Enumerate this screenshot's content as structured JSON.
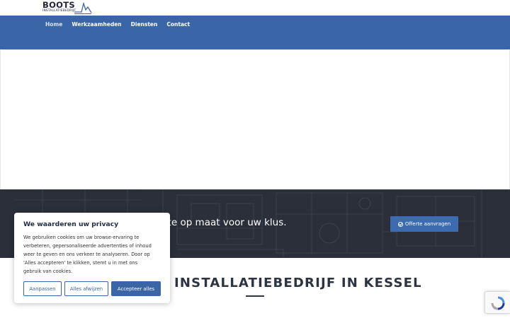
{
  "brand": {
    "name": "BOOTS",
    "tagline": "INSTALLATIEBEDRIJF"
  },
  "nav": {
    "items": [
      {
        "label": "Home"
      },
      {
        "label": "Werkzaamheden"
      },
      {
        "label": "Diensten"
      },
      {
        "label": "Contact"
      }
    ],
    "active": "Home"
  },
  "cta": {
    "text": "rte op maat voor uw klus.",
    "button_label": "Offerte aanvragen",
    "button_icon": "check-circle-icon"
  },
  "section": {
    "title": "INSTALLATIEBEDRIJF IN KESSEL"
  },
  "cookie": {
    "title": "We waarderen uw privacy",
    "body_lines": [
      "We gebruiken cookies om uw browse-ervaring te",
      "verbeteren, gepersonaliseerde advertenties of inhoud",
      "weer te geven en ons verkeer te analyseren. Door op",
      "'Alles accepteren' te klikken, stemt u in met ons",
      "gebruik van cookies."
    ],
    "btn_customize": "Aanpassen",
    "btn_reject": "Alles afwijzen",
    "btn_accept": "Accepteer alles"
  },
  "colors": {
    "primary": "#3a66a8",
    "dark_band": "#2a2f39",
    "heading": "#2c3442"
  }
}
